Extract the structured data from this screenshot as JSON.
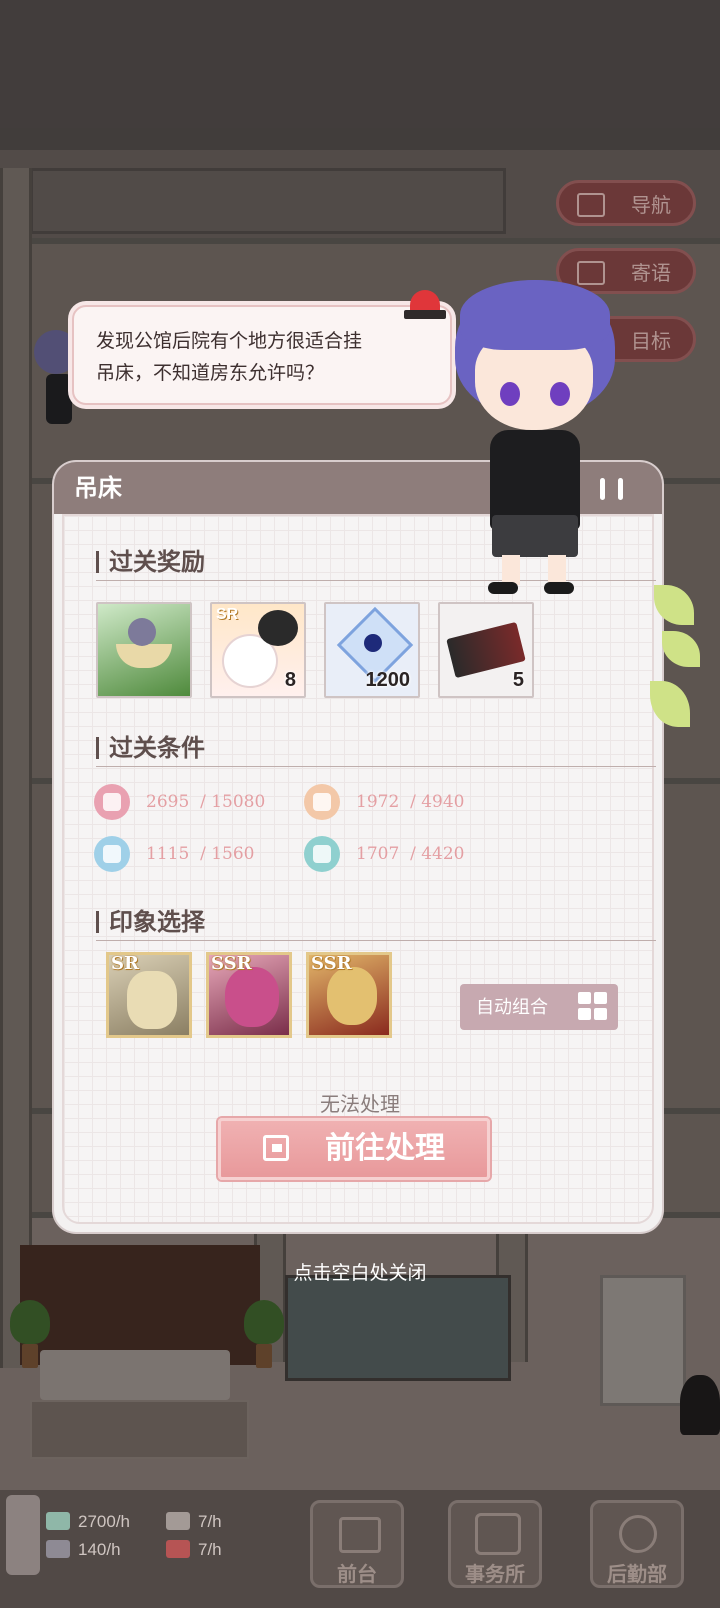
{
  "side_nav": {
    "navigation": "导航",
    "messages": "寄语",
    "goals": "目标"
  },
  "speech_bubble": {
    "text_line1": "发现公馆后院有个地方很适合挂",
    "text_line2": "吊床，不知道房东允许吗？"
  },
  "event_card": {
    "title": "吊床",
    "rewards_section": {
      "heading": "过关奖励",
      "items": [
        {
          "name": "hammock-card",
          "count": ""
        },
        {
          "name": "sr-cat-card",
          "badge": "SR",
          "count": "8"
        },
        {
          "name": "blue-gem",
          "count": "1200"
        },
        {
          "name": "ticket",
          "count": "5"
        }
      ]
    },
    "conditions_section": {
      "heading": "过关条件",
      "stats": [
        {
          "icon": "dumbbell-icon",
          "current": "2695",
          "required": "/ 15080",
          "color": "#e9a1b1"
        },
        {
          "icon": "person-icon",
          "current": "1972",
          "required": "/ 4940",
          "color": "#f3c8a8"
        },
        {
          "icon": "graduation-cap-icon",
          "current": "1115",
          "required": "/ 1560",
          "color": "#9fd0e8"
        },
        {
          "icon": "flower-icon",
          "current": "1707",
          "required": "/ 4420",
          "color": "#8fd0cf"
        }
      ]
    },
    "impression_section": {
      "heading": "印象选择",
      "portraits": [
        {
          "rank": "SR"
        },
        {
          "rank": "SSR"
        },
        {
          "rank": "SSR"
        }
      ],
      "auto_button": "自动组合"
    },
    "status_text": "无法处理",
    "go_button": "前往处理"
  },
  "close_hint": "点击空白处关闭",
  "bottom_bar": {
    "resources": [
      {
        "icon": "cash-icon",
        "value": "2700/h"
      },
      {
        "icon": "person-icon",
        "value": "7/h"
      },
      {
        "icon": "book-icon",
        "value": "140/h"
      },
      {
        "icon": "gift-icon",
        "value": "7/h"
      }
    ],
    "tabs": [
      "前台",
      "事务所",
      "后勤部"
    ]
  }
}
